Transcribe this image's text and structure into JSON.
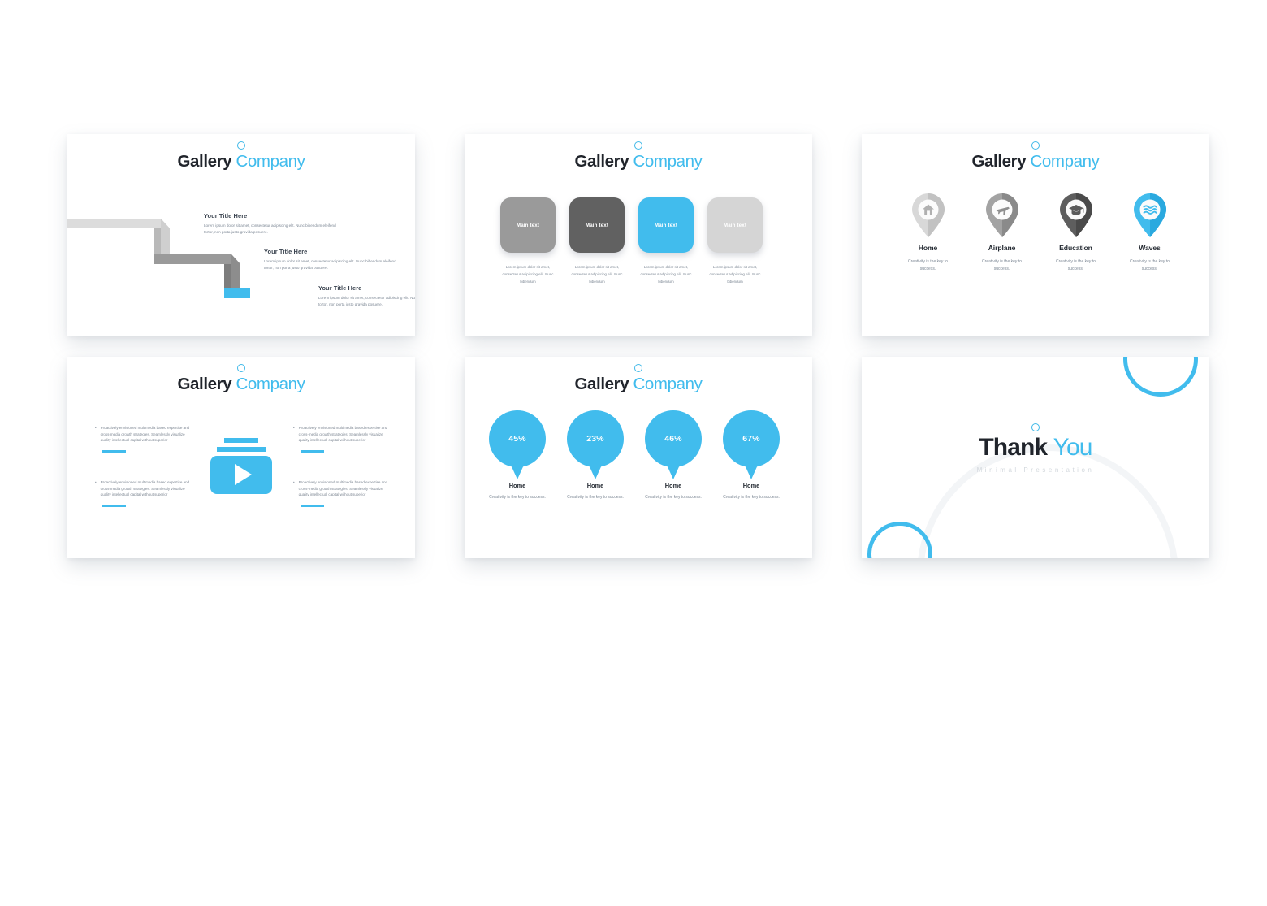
{
  "theme": {
    "accent_blue": "#41bced",
    "dark_text": "#20242b",
    "body_text": "#7c8794",
    "gray_light": "#d5d5d5",
    "gray_mid": "#949494",
    "gray_dark": "#6b6b6b"
  },
  "brand": {
    "title_dark": "Gallery",
    "title_accent": "Company"
  },
  "slide1": {
    "name": "staircase-slide",
    "items": [
      {
        "heading": "Your Title Here",
        "body": "Lorem ipsum dolor sit amet, consectetur adipiscing elit. Nunc bibendum eleifend tortor, non porta justo gravida posuere."
      },
      {
        "heading": "Your Title Here",
        "body": "Lorem ipsum dolor sit amet, consectetur adipiscing elit. Nunc bibendum eleifend tortor, non porta justo gravida posuere."
      },
      {
        "heading": "Your Title Here",
        "body": "Lorem ipsum dolor sit amet, consectetur adipiscing elit. Nunc bibendum eleifend tortor, non porta justo gravida posuere."
      }
    ]
  },
  "slide2": {
    "name": "cards-slide",
    "cards": [
      {
        "label": "Main text",
        "color": "#9a9a9a",
        "body": "Lorem ipsum dolor sit amet, consectetur adipiscing elit. Nunc bibendum"
      },
      {
        "label": "Main text",
        "color": "#616161",
        "body": "Lorem ipsum dolor sit amet, consectetur adipiscing elit. Nunc bibendum"
      },
      {
        "label": "Main text",
        "color": "#41bced",
        "body": "Lorem ipsum dolor sit amet, consectetur adipiscing elit. Nunc bibendum"
      },
      {
        "label": "Main text",
        "color": "#d5d5d5",
        "body": "Lorem ipsum dolor sit amet, consectetur adipiscing elit. Nunc bibendum"
      }
    ]
  },
  "slide3": {
    "name": "map-pins-slide",
    "pins": [
      {
        "icon": "home-icon",
        "label": "Home",
        "body": "Creativity is the key to success.",
        "color": "#d8d8d8",
        "shade": "#c2c2c2"
      },
      {
        "icon": "airplane-icon",
        "label": "Airplane",
        "body": "Creativity is the key to success.",
        "color": "#a3a3a3",
        "shade": "#8a8a8a"
      },
      {
        "icon": "graduation-cap-icon",
        "label": "Education",
        "body": "Creativity is the key to success.",
        "color": "#5e5e5e",
        "shade": "#4a4a4a"
      },
      {
        "icon": "waves-icon",
        "label": "Waves",
        "body": "Creativity is the key to success.",
        "color": "#41bced",
        "shade": "#2aa9df"
      }
    ]
  },
  "slide4": {
    "name": "media-slide",
    "bullet_text": "Proactively envisioned multimedia based expertise and cross-media growth strategies. Seamlessly visualize quality intellectual capital without superior",
    "bullets": [
      "Proactively envisioned multimedia based expertise and cross-media growth strategies. Seamlessly visualize quality intellectual capital without superior",
      "Proactively envisioned multimedia based expertise and cross-media growth strategies. Seamlessly visualize quality intellectual capital without superior",
      "Proactively envisioned multimedia based expertise and cross-media growth strategies. Seamlessly visualize quality intellectual capital without superior",
      "Proactively envisioned multimedia based expertise and cross-media growth strategies. Seamlessly visualize quality intellectual capital without superior"
    ],
    "bullet_marker": "•",
    "center_icon": "video-player-icon"
  },
  "slide5": {
    "name": "percentage-balloons-slide",
    "balloons": [
      {
        "percent": "45%",
        "label": "Home",
        "body": "Creativity is the key to success."
      },
      {
        "percent": "23%",
        "label": "Home",
        "body": "Creativity is the key to success."
      },
      {
        "percent": "46%",
        "label": "Home",
        "body": "Creativity is the key to success."
      },
      {
        "percent": "67%",
        "label": "Home",
        "body": "Creativity is the key to success."
      }
    ]
  },
  "slide6": {
    "name": "thank-you-slide",
    "title_dark": "Thank",
    "title_accent": "You",
    "subtitle": "Minimal Presentation"
  }
}
